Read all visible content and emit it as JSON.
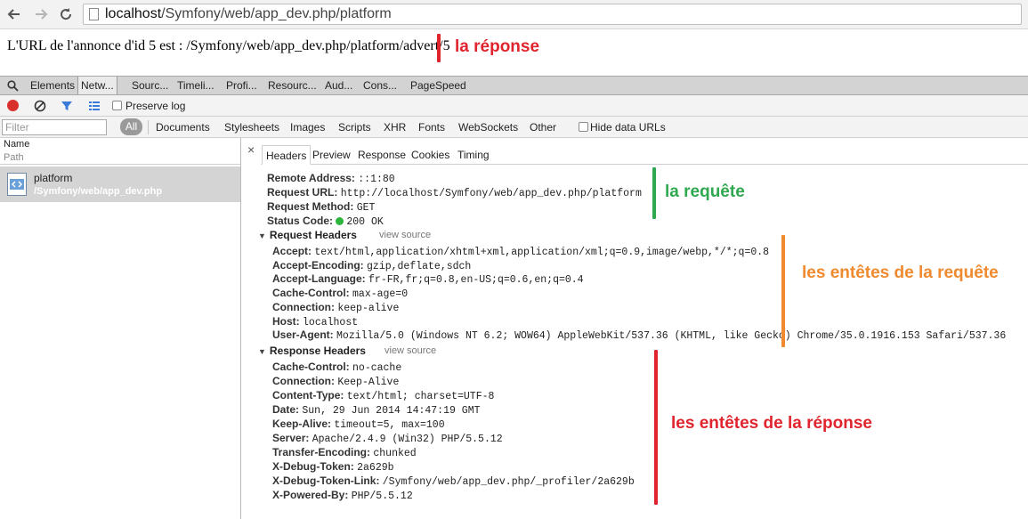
{
  "browser": {
    "url_host": "localhost",
    "url_path": "/Symfony/web/app_dev.php/platform"
  },
  "page": {
    "text": "L'URL de l'annonce d'id 5 est : /Symfony/web/app_dev.php/platform/advert/5"
  },
  "annotations": {
    "response": "la réponse",
    "request": "la requête",
    "request_headers": "les entêtes de la requête",
    "response_headers": "les entêtes de la réponse",
    "colors": {
      "red": "#e0242e",
      "green": "#2fa84f",
      "orange": "#f08a2e"
    }
  },
  "devtools": {
    "tabs": [
      "Elements",
      "Netw...",
      "Sourc...",
      "Timeli...",
      "Profi...",
      "Resourc...",
      "Aud...",
      "Cons...",
      "PageSpeed"
    ],
    "active_tab": "Netw...",
    "preserve_log": "Preserve log",
    "filter_placeholder": "Filter",
    "filter_all": "All",
    "filter_types": [
      "Documents",
      "Stylesheets",
      "Images",
      "Scripts",
      "XHR",
      "Fonts",
      "WebSockets",
      "Other"
    ],
    "hide_data_urls": "Hide data URLs",
    "columns": {
      "name": "Name",
      "path": "Path"
    },
    "request": {
      "name": "platform",
      "path": "/Symfony/web/app_dev.php"
    },
    "detail_tabs": [
      "Headers",
      "Preview",
      "Response",
      "Cookies",
      "Timing"
    ],
    "close_glyph": "×"
  },
  "general": [
    {
      "k": "Remote Address:",
      "v": "::1:80"
    },
    {
      "k": "Request URL:",
      "v": "http://localhost/Symfony/web/app_dev.php/platform"
    },
    {
      "k": "Request Method:",
      "v": "GET"
    },
    {
      "k": "Status Code:",
      "v": "200 OK"
    }
  ],
  "request_headers": {
    "title": "Request Headers",
    "view_source": "view source",
    "items": [
      {
        "k": "Accept:",
        "v": "text/html,application/xhtml+xml,application/xml;q=0.9,image/webp,*/*;q=0.8"
      },
      {
        "k": "Accept-Encoding:",
        "v": "gzip,deflate,sdch"
      },
      {
        "k": "Accept-Language:",
        "v": "fr-FR,fr;q=0.8,en-US;q=0.6,en;q=0.4"
      },
      {
        "k": "Cache-Control:",
        "v": "max-age=0"
      },
      {
        "k": "Connection:",
        "v": "keep-alive"
      },
      {
        "k": "Host:",
        "v": "localhost"
      },
      {
        "k": "User-Agent:",
        "v": "Mozilla/5.0 (Windows NT 6.2; WOW64) AppleWebKit/537.36 (KHTML, like Gecko) Chrome/35.0.1916.153 Safari/537.36"
      }
    ]
  },
  "response_headers": {
    "title": "Response Headers",
    "view_source": "view source",
    "items": [
      {
        "k": "Cache-Control:",
        "v": "no-cache"
      },
      {
        "k": "Connection:",
        "v": "Keep-Alive"
      },
      {
        "k": "Content-Type:",
        "v": "text/html; charset=UTF-8"
      },
      {
        "k": "Date:",
        "v": "Sun, 29 Jun 2014 14:47:19 GMT"
      },
      {
        "k": "Keep-Alive:",
        "v": "timeout=5, max=100"
      },
      {
        "k": "Server:",
        "v": "Apache/2.4.9 (Win32) PHP/5.5.12"
      },
      {
        "k": "Transfer-Encoding:",
        "v": "chunked"
      },
      {
        "k": "X-Debug-Token:",
        "v": "2a629b"
      },
      {
        "k": "X-Debug-Token-Link:",
        "v": "/Symfony/web/app_dev.php/_profiler/2a629b"
      },
      {
        "k": "X-Powered-By:",
        "v": "PHP/5.5.12"
      }
    ]
  }
}
